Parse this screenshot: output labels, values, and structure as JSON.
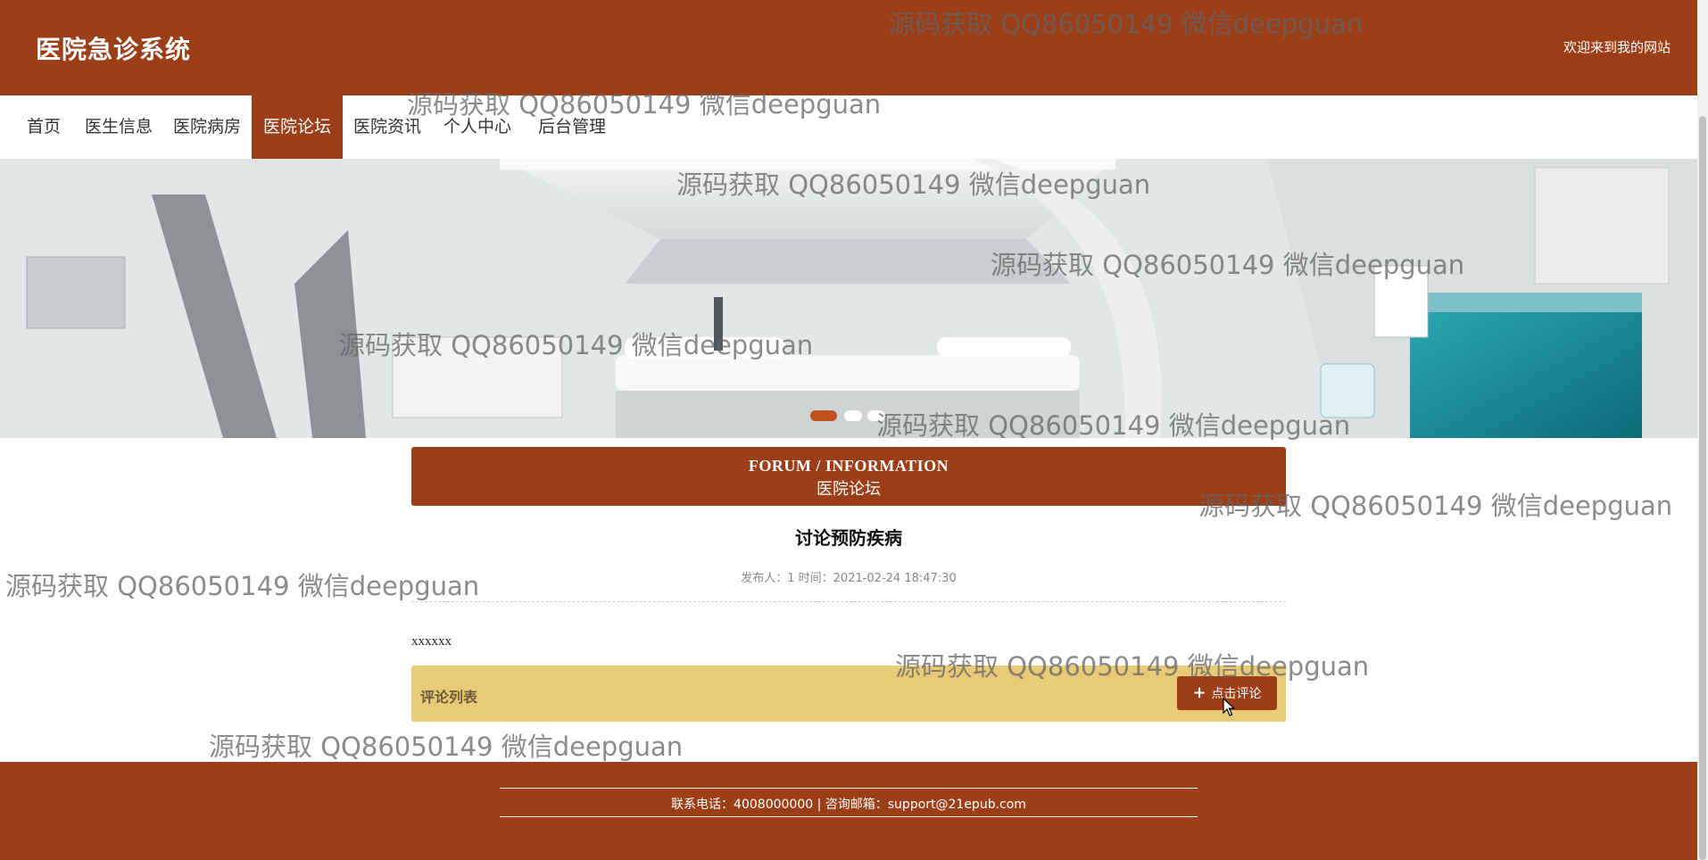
{
  "header": {
    "title": "医院急诊系统",
    "welcome": "欢迎来到我的网站"
  },
  "nav": {
    "items": [
      "首页",
      "医生信息",
      "医院病房",
      "医院论坛",
      "医院资讯",
      "个人中心",
      "后台管理"
    ],
    "active": "医院论坛"
  },
  "banner": {
    "slide_count": 3,
    "active_slide": 1
  },
  "section": {
    "title_en": "FORUM / INFORMATION",
    "title_cn": "医院论坛"
  },
  "post": {
    "title": "讨论预防疾病",
    "meta": "发布人：1 时间：2021-02-24 18:47:30",
    "content": "xxxxxx"
  },
  "comments": {
    "label": "评论列表",
    "button_label": "点击评论"
  },
  "footer": {
    "contact": "联系电话：4008000000 | 咨询邮箱：support@21epub.com"
  },
  "watermark": {
    "text": "源码获取 QQ86050149 微信deepguan"
  },
  "colors": {
    "brand": "#9c3f18",
    "comment_bar": "#e9cb77",
    "active_dot": "#c0501e"
  }
}
